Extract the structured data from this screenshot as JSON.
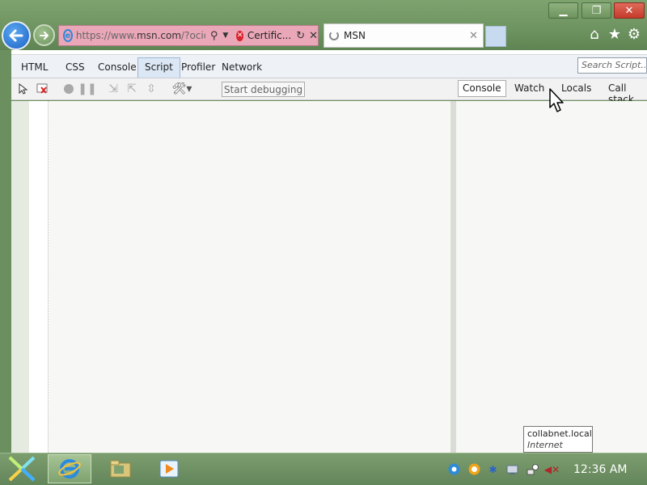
{
  "window": {
    "minimize_label": "▁",
    "restore_label": "❐",
    "close_label": "✕"
  },
  "nav": {
    "back_icon": "arrow-left-icon",
    "forward_icon": "arrow-right-icon"
  },
  "address_bar": {
    "url_prefix": "https://www.",
    "url_host": "msn.com",
    "url_rest": "/?ocid",
    "certificate_label": "Certific..."
  },
  "tabs": [
    {
      "title": "MSN",
      "loading": true
    }
  ],
  "devtools": {
    "tabs": [
      "HTML",
      "CSS",
      "Console",
      "Script",
      "Profiler",
      "Network"
    ],
    "active_tab": "Script",
    "search_placeholder": "Search Script...",
    "start_debugging_label": "Start debugging",
    "right_tabs": [
      "Console",
      "Watch",
      "Locals",
      "Call stack"
    ],
    "active_right_tab": "Console"
  },
  "tooltip": {
    "title": "collabnet.local",
    "subtitle": "Internet access"
  },
  "taskbar": {
    "clock": "12:36 AM"
  },
  "colors": {
    "chrome_green": "#6d9360",
    "address_bar_pink": "#e9a7b8",
    "close_red": "#c43b2b",
    "devtools_tab_bg": "#eef2f7"
  }
}
